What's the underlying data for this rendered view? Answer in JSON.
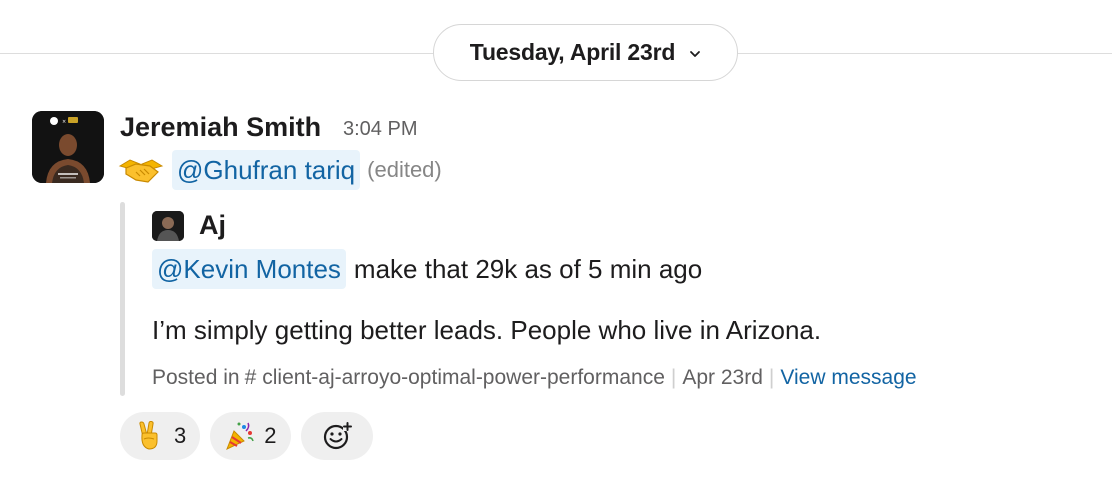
{
  "date_divider": {
    "label": "Tuesday, April 23rd",
    "icon": "chevron-down-icon"
  },
  "message": {
    "sender": "Jeremiah Smith",
    "time": "3:04 PM",
    "emoji": "handshake",
    "mention": "@Ghufran tariq",
    "edited": "(edited)"
  },
  "quoted": {
    "author": "Aj",
    "mention": "@Kevin Montes",
    "line1_text": "make that 29k as of 5 min ago",
    "line2_text": "I’m simply getting better leads. People who live in Arizona.",
    "posted_in_label": "Posted in",
    "channel": "client-aj-arroyo-optimal-power-performance",
    "date": "Apr 23rd",
    "view_link": "View message"
  },
  "reactions": [
    {
      "emoji": "victory-hand",
      "count": "3"
    },
    {
      "emoji": "party-popper",
      "count": "2"
    }
  ],
  "add_reaction_icon": "add-reaction-icon",
  "colors": {
    "mention_bg": "#e8f3fb",
    "mention_text": "#1264a3",
    "link": "#1264a3",
    "meta": "#616061",
    "reaction_bg": "#efefef"
  }
}
